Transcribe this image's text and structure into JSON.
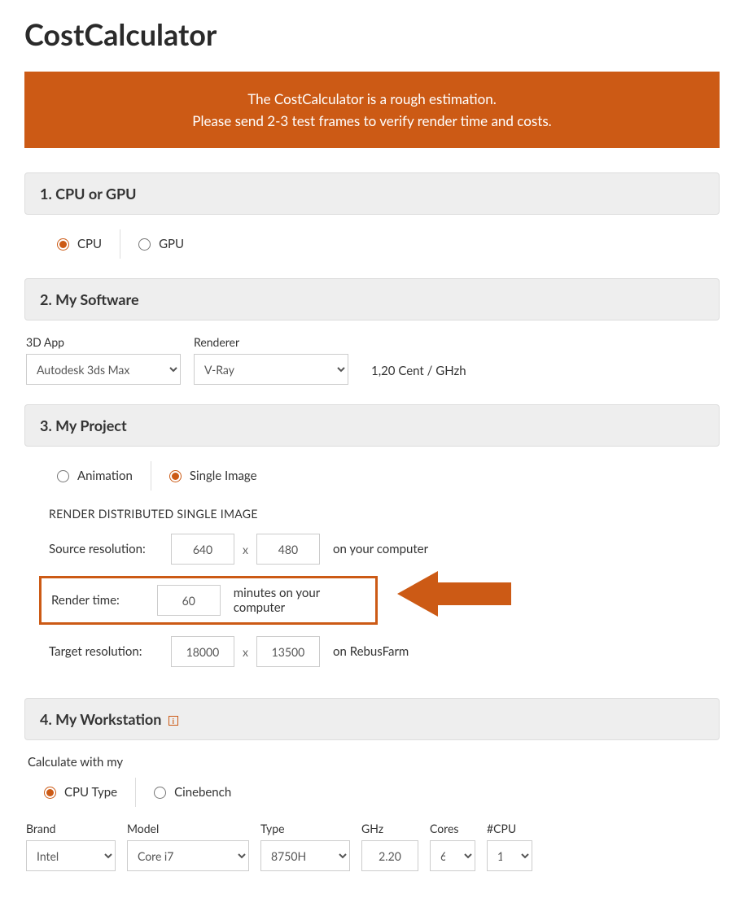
{
  "title": "CostCalculator",
  "banner": {
    "line1": "The CostCalculator is a rough estimation.",
    "line2": "Please send 2-3 test frames to verify render time and costs."
  },
  "section1": {
    "heading": "1. CPU or GPU",
    "options": {
      "cpu": "CPU",
      "gpu": "GPU"
    },
    "selected": "cpu"
  },
  "section2": {
    "heading": "2. My Software",
    "app_label": "3D App",
    "app_value": "Autodesk 3ds Max",
    "renderer_label": "Renderer",
    "renderer_value": "V-Ray",
    "price": "1,20 Cent / GHzh"
  },
  "section3": {
    "heading": "3. My Project",
    "options": {
      "animation": "Animation",
      "single": "Single Image"
    },
    "subhead": "RENDER DISTRIBUTED SINGLE IMAGE",
    "source_label": "Source resolution:",
    "source_w": "640",
    "source_h": "480",
    "source_suffix": "on your computer",
    "render_label": "Render time:",
    "render_value": "60",
    "render_suffix": "minutes on your computer",
    "target_label": "Target resolution:",
    "target_w": "18000",
    "target_h": "13500",
    "target_suffix": "on RebusFarm",
    "x": "x"
  },
  "section4": {
    "heading": "4. My Workstation",
    "calc_label": "Calculate with my",
    "options": {
      "cputype": "CPU Type",
      "cinebench": "Cinebench"
    },
    "brand_label": "Brand",
    "brand_value": "Intel",
    "model_label": "Model",
    "model_value": "Core i7",
    "type_label": "Type",
    "type_value": "8750H",
    "ghz_label": "GHz",
    "ghz_value": "2.20",
    "cores_label": "Cores",
    "cores_value": "6",
    "ncpu_label": "#CPU",
    "ncpu_value": "1"
  }
}
